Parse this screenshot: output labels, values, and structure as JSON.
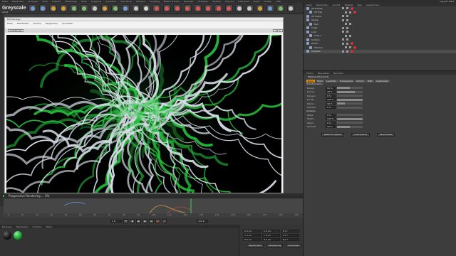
{
  "app": {
    "menu": [
      "Datei",
      "Bearbeiten",
      "Erzeugen",
      "Modi",
      "Auswahl",
      "Werkzeuge",
      "Mesh",
      "Snapping",
      "Animation",
      "Simulieren",
      "Rendern",
      "Sculpting",
      "Motion Tracker",
      "MoGraph",
      "Charakter",
      "Pipeline",
      "Plug-ins",
      "X-Particles",
      "Skript",
      "Fenster",
      "Hilfe"
    ],
    "layout_label": "Layout: Start"
  },
  "logo": {
    "text": "Greyscale",
    "sub": "gorilla"
  },
  "render_window": {
    "title": "Bildmanager",
    "menu": [
      "Datei",
      "Bearbeiten",
      "Ansicht",
      "Vergleichen",
      "Animation"
    ],
    "display_mode": "Vollständig",
    "zoom": "75 %"
  },
  "status": {
    "text": "Progressive Rendering ... 0%",
    "progress_fraction": 0.0
  },
  "timeline": {
    "ticks": [
      "0",
      "10",
      "20",
      "30",
      "40",
      "50",
      "60",
      "70",
      "80",
      "90",
      "100",
      "110",
      "120",
      "130",
      "140",
      "150",
      "160",
      "170",
      "180",
      "190"
    ],
    "frame_field": "0 B",
    "end_field": "190 B"
  },
  "material_manager": {
    "tabs": [
      "Erzeugen",
      "Bearbeiten",
      "Funktion",
      "Textur"
    ]
  },
  "coordinates": {
    "rows": [
      {
        "a": "X 0 cm",
        "b": "X 0 cm",
        "c": "H 0 °"
      },
      {
        "a": "Y 0 cm",
        "b": "Y 0 cm",
        "c": "P 0 °"
      },
      {
        "a": "Z 0 cm",
        "b": "Z 0 cm",
        "c": "B 0 °"
      }
    ],
    "mode_a": "Objekt (Rel)",
    "mode_b": "Abmessung",
    "apply": "Anwenden"
  },
  "object_manager": {
    "menu": [
      "Datei",
      "Bearbeiten",
      "Ansicht",
      "Objekte",
      "Tags",
      "Lesezeichen"
    ],
    "objects": [
      "XP Emitter",
      "XP Trail",
      "XP Cache",
      "Sweep",
      "Null",
      "Kugel",
      "Licht",
      "Licht.1",
      "Kamera",
      "Boden",
      "Himmel",
      "Xpressio"
    ]
  },
  "attribute_manager": {
    "menu": [
      "Modus",
      "Bearbeiten",
      "Benutzer"
    ],
    "title": "Material [Standard]",
    "tabs": [
      "Basis",
      "Farbe",
      "Leuchten",
      "Transparenz",
      "Glühen",
      "Matt",
      "Ausblenden"
    ],
    "section1": "Transformation",
    "params": [
      {
        "label": "Radius",
        "value": "50 %",
        "fill": 0.5
      },
      {
        "label": "Kurven",
        "value": "70 %",
        "fill": 0.7
      },
      {
        "label": "Polygon",
        "value": "0 %",
        "fill": 0.0
      },
      {
        "label": "Dichte",
        "value": "100 %",
        "fill": 1.0
      },
      {
        "label": "Fläche",
        "value": "30 %",
        "fill": 0.3
      },
      {
        "label": "Abstand",
        "value": "0 %",
        "fill": 0.0
      }
    ],
    "section2": "Ansehen",
    "params2": [
      {
        "label": "Farbe",
        "value": "0 %",
        "fill": 0.0
      },
      {
        "label": "Stärke",
        "value": "100 %",
        "fill": 1.0
      },
      {
        "label": "Weich",
        "value": "0 %",
        "fill": 0.0
      },
      {
        "label": "Kontrast",
        "value": "50 %",
        "fill": 0.5
      }
    ],
    "buttons": [
      "Reset to Default",
      "Load Preset",
      "Save Preset"
    ]
  },
  "colors": {
    "accent": "#d98f1e",
    "tendril_green": "#27c23e",
    "tendril_white": "#d6dde6",
    "render_bg": "#000000"
  }
}
